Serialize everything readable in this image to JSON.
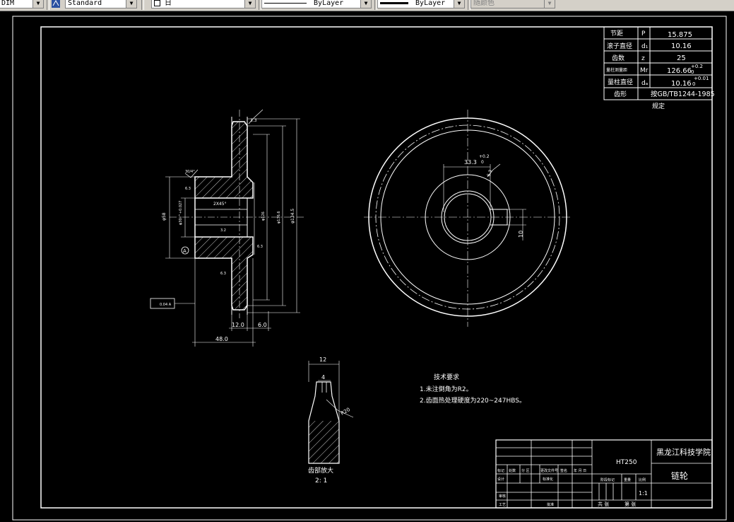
{
  "toolbar": {
    "dimstyle": "DIM",
    "textstyle": "Standard",
    "layer": "日",
    "linetype": "ByLayer",
    "lineweight": "ByLayer",
    "color": "随颜色"
  },
  "params_table": {
    "rows": [
      {
        "label": "节距",
        "symbol": "P",
        "value": "15.875"
      },
      {
        "label": "滚子直径",
        "symbol": "d₁",
        "value": "10.16"
      },
      {
        "label": "齿数",
        "symbol": "z",
        "value": "25"
      },
      {
        "label": "量柱测量距",
        "symbol": "Mr",
        "value": "126.66",
        "tol_upper": "+0.2",
        "tol_lower": "0"
      },
      {
        "label": "量柱直径",
        "symbol": "dₐ",
        "value": "10.16",
        "tol_upper": "+0.01",
        "tol_lower": "0"
      },
      {
        "label": "齿形",
        "symbol": "",
        "value": "按GB/TB1244-1985"
      }
    ],
    "footnote": "规定"
  },
  "section_view": {
    "chamfer_top": "3.3",
    "angle": "30/4°",
    "bore_dims": [
      "φ58",
      "φ30₀^+0.027",
      "φ126",
      "φ136.6",
      "φ134.5"
    ],
    "keyway": "2X45°",
    "roughness_left": "6.3",
    "roughness_inner": "3.2",
    "roughness_right": "6.3",
    "roughness_bottom": "6.3",
    "width_hub": "12.0",
    "width_gap": "6.0",
    "total_width": "48.0",
    "datum": "A",
    "tolerance_box": "0.04 A"
  },
  "front_view": {
    "key_width": "33.3",
    "key_tol_upper": "+0.2",
    "key_tol_lower": "0",
    "roughness": "6.3",
    "key_depth": "10"
  },
  "detail_view": {
    "width": "12",
    "tip": "4",
    "radius": "R20",
    "caption": "齿部放大",
    "scale": "2: 1"
  },
  "tech_requirements": {
    "title": "技术要求",
    "items": [
      "1.未注倒角为R2。",
      "2.齿面热处理硬度为220~247HBS。"
    ]
  },
  "title_block": {
    "material": "HT250",
    "school": "黑龙江科技学院",
    "part_name": "链轮",
    "scale": "1:1",
    "row_labels": [
      "标记",
      "处数",
      "分 区",
      "更改文件号",
      "签名",
      "年 月 日"
    ],
    "row2_labels": [
      "设计",
      "标准化"
    ],
    "stage": "阶段标记",
    "weight": "重量",
    "ratio": "比例",
    "review": "审核",
    "process": "工艺",
    "approve": "批准",
    "sheets_total": "共 张",
    "sheet_no": "第 张"
  }
}
